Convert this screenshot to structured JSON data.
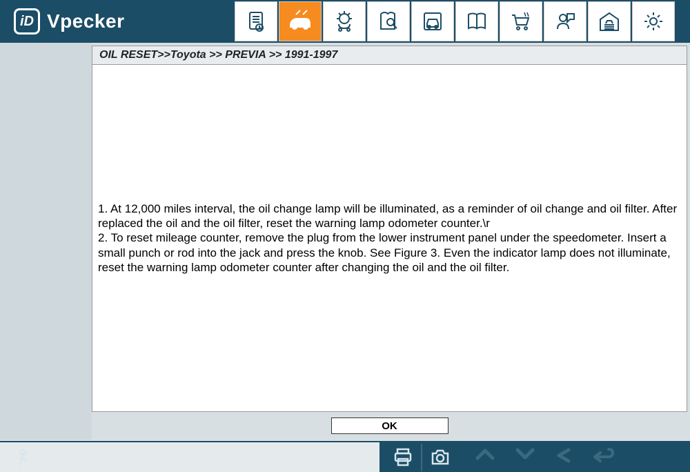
{
  "app": {
    "name": "Vpecker"
  },
  "breadcrumb": "OIL RESET>>Toyota >> PREVIA >> 1991-1997",
  "instructions": {
    "line1": "1. At 12,000 miles interval, the oil change lamp will be illuminated, as a reminder of oil change and oil filter. After replaced the oil and the oil filter, reset the warning lamp odometer counter.\\r",
    "line2": "2. To reset mileage counter, remove the plug from the lower instrument panel under the speedometer. Insert a small punch or rod into the jack and press the knob. See Figure 3. Even the indicator lamp does not illuminate, reset the warning lamp odometer counter after changing the oil and the oil filter."
  },
  "buttons": {
    "ok": "OK"
  },
  "toolbar_icons": [
    "document",
    "car-diagnostic",
    "engine",
    "search-manual",
    "vehicle",
    "book",
    "cart",
    "support",
    "garage",
    "settings"
  ],
  "footer_icons": [
    "exit",
    "print",
    "camera",
    "up",
    "down",
    "back",
    "return"
  ]
}
